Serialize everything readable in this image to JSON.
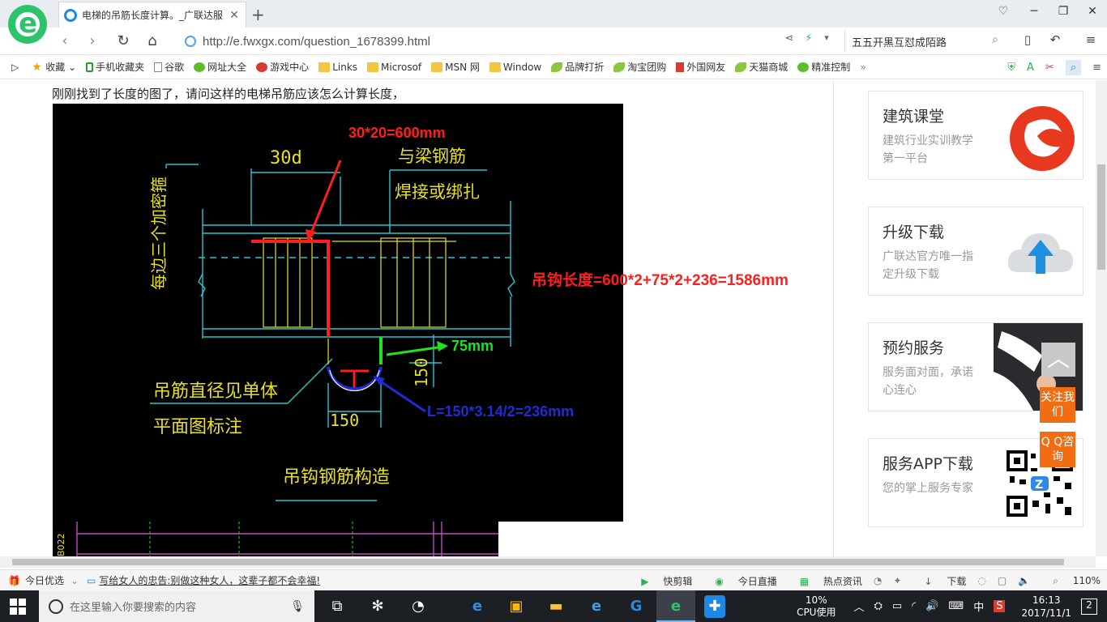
{
  "tab": {
    "title": "电梯的吊筋长度计算。_广联达服"
  },
  "address": {
    "url": "http://e.fwxgx.com/question_1678399.html"
  },
  "search": {
    "value": "五五开黑互怼成陌路"
  },
  "bookmarks": [
    {
      "label": "收藏",
      "icon": "star-icon"
    },
    {
      "label": "手机收藏夹",
      "icon": "phone-icon"
    },
    {
      "label": "谷歌",
      "icon": "doc-icon"
    },
    {
      "label": "网址大全",
      "icon": "globe-icon"
    },
    {
      "label": "游戏中心",
      "icon": "game-icon"
    },
    {
      "label": "Links",
      "icon": "folder-icon"
    },
    {
      "label": "Microsof",
      "icon": "folder-icon"
    },
    {
      "label": "MSN 网",
      "icon": "folder-icon"
    },
    {
      "label": "Window",
      "icon": "folder-icon"
    },
    {
      "label": "品牌打折",
      "icon": "leaf-icon"
    },
    {
      "label": "淘宝团购",
      "icon": "leaf-icon"
    },
    {
      "label": "外国网友",
      "icon": "flag-icon"
    },
    {
      "label": "天猫商城",
      "icon": "leaf-icon"
    },
    {
      "label": "精准控制",
      "icon": "chat-icon"
    }
  ],
  "page": {
    "question": "刚刚找到了长度的图了，请问这样的电梯吊筋应该怎么计算长度，"
  },
  "drawing": {
    "label_30d": "30d",
    "beam_text_1": "与梁钢筋",
    "beam_text_2": "焊接或绑扎",
    "side_text": "每边三个加密箍",
    "dim_top": "30*20=600mm",
    "formula": "吊钩长度=600*2+75*2+236=1586mm",
    "dim_hook": "75mm",
    "dim_150_v": "150",
    "dim_150_h": "150",
    "arc_formula": "L=150*3.14/2=236mm",
    "note_1": "吊筋直径见单体",
    "note_2": "平面图标注",
    "caption": "吊钩钢筋构造",
    "bottom_label": "B022"
  },
  "sidebar": {
    "cards": [
      {
        "title": "建筑课堂",
        "sub": "建筑行业实训教学第一平台",
        "icon": "logo-icon"
      },
      {
        "title": "升级下载",
        "sub": "广联达官方唯一指定升级下载",
        "icon": "cloud-upload-icon"
      },
      {
        "title": "预约服务",
        "sub": "服务面对面，承诺心连心",
        "icon": "handshake-icon"
      },
      {
        "title": "服务APP下载",
        "sub": "您的掌上服务专家",
        "icon": "qr-code-icon"
      }
    ],
    "totop": "︿",
    "follow": "关注我们",
    "qq": "Q Q咨询"
  },
  "statusbar": {
    "today": "今日优选",
    "news": "写给女人的忠告:别做这种女人，这辈子都不会幸福!",
    "clip": "快剪辑",
    "live": "今日直播",
    "hot": "热点资讯",
    "download": "下载",
    "zoom": "110%"
  },
  "taskbar": {
    "search_placeholder": "在这里输入你要搜索的内容",
    "cpu_value": "10%",
    "cpu_label": "CPU使用",
    "ime": "中",
    "time": "16:13",
    "date": "2017/11/1",
    "notifications": "2"
  }
}
